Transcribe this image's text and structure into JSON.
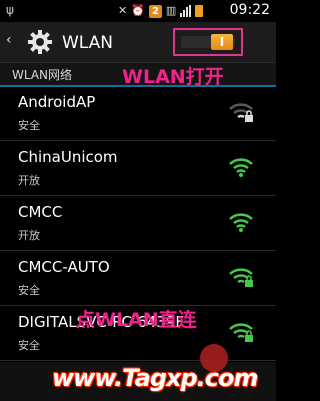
{
  "statusbar": {
    "time": "09:22",
    "notification_count": "2",
    "usb_icon": "usb-icon",
    "mute_icon": "mute-icon",
    "alarm_icon": "alarm-icon",
    "signal_icon": "signal-icon",
    "battery_icon": "battery-icon"
  },
  "actionbar": {
    "title": "WLAN",
    "toggle_thumb": "I",
    "toggle_on": true,
    "accent": "#e48b10"
  },
  "section": {
    "label": "WLAN网络"
  },
  "overlays": {
    "open_text": "WLAN打开",
    "direct_text": "点WLAN直连",
    "color": "#f2228c"
  },
  "networks": [
    {
      "name": "AndroidAP",
      "status": "安全",
      "secured": true,
      "signal": "weak"
    },
    {
      "name": "ChinaUnicom",
      "status": "开放",
      "secured": false,
      "signal": "strong"
    },
    {
      "name": "CMCC",
      "status": "开放",
      "secured": false,
      "signal": "strong"
    },
    {
      "name": "CMCC-AUTO",
      "status": "安全",
      "secured": true,
      "signal": "strong"
    },
    {
      "name": "DIGITALSVC-PC-6439F",
      "status": "安全",
      "secured": true,
      "signal": "strong"
    }
  ],
  "watermark": {
    "text": "www.Tagxp.com",
    "color": "#ff2a00"
  }
}
